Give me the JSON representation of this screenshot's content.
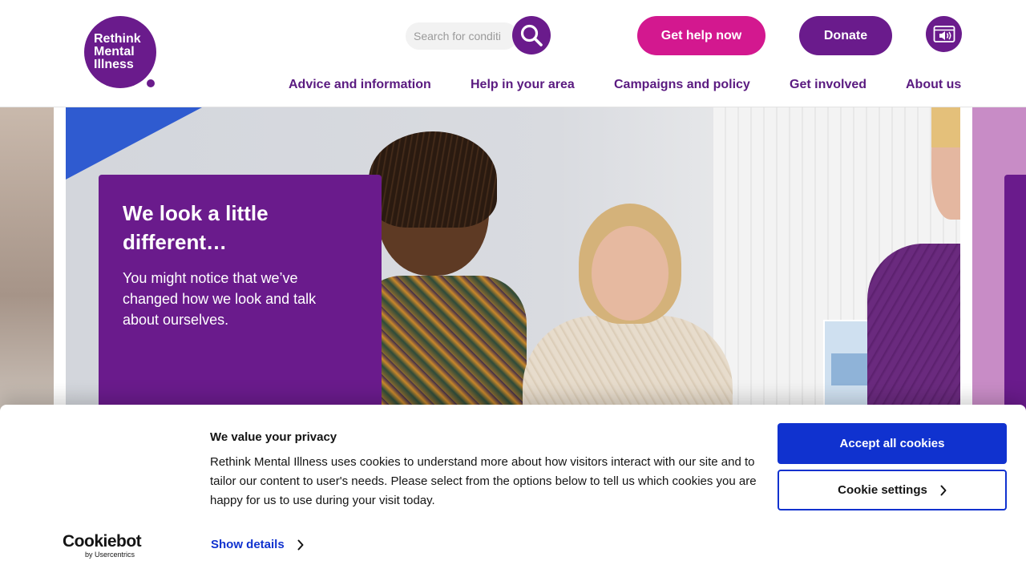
{
  "header": {
    "logo_text": "Rethink\nMental\nIllness",
    "search_placeholder": "Search for conditions",
    "help_button": "Get help now",
    "donate_button": "Donate",
    "nav": [
      {
        "label": "Advice and information"
      },
      {
        "label": "Help in your area"
      },
      {
        "label": "Campaigns and policy"
      },
      {
        "label": "Get involved"
      },
      {
        "label": "About us"
      }
    ]
  },
  "hero": {
    "title": "We look a little different…",
    "body": "You might notice that we’ve changed how we look and talk about ourselves."
  },
  "cookie_banner": {
    "title": "We value your privacy",
    "text": "Rethink Mental Illness uses cookies to understand more about how visitors interact with our site and to tailor our content to user's needs. Please select from the options below to tell us which cookies you are happy for us to use during your visit today.",
    "show_details": "Show details",
    "accept_button": "Accept all cookies",
    "settings_button": "Cookie settings",
    "brand_name": "Cookiebot",
    "brand_sub": "by Usercentrics"
  },
  "colors": {
    "brand_purple": "#6a1b8c",
    "help_pink": "#d3188f",
    "cookie_blue": "#1032cf"
  },
  "icons": [
    "search-icon",
    "accessibility-audio-icon",
    "chevron-left-icon",
    "chevron-right-icon"
  ]
}
